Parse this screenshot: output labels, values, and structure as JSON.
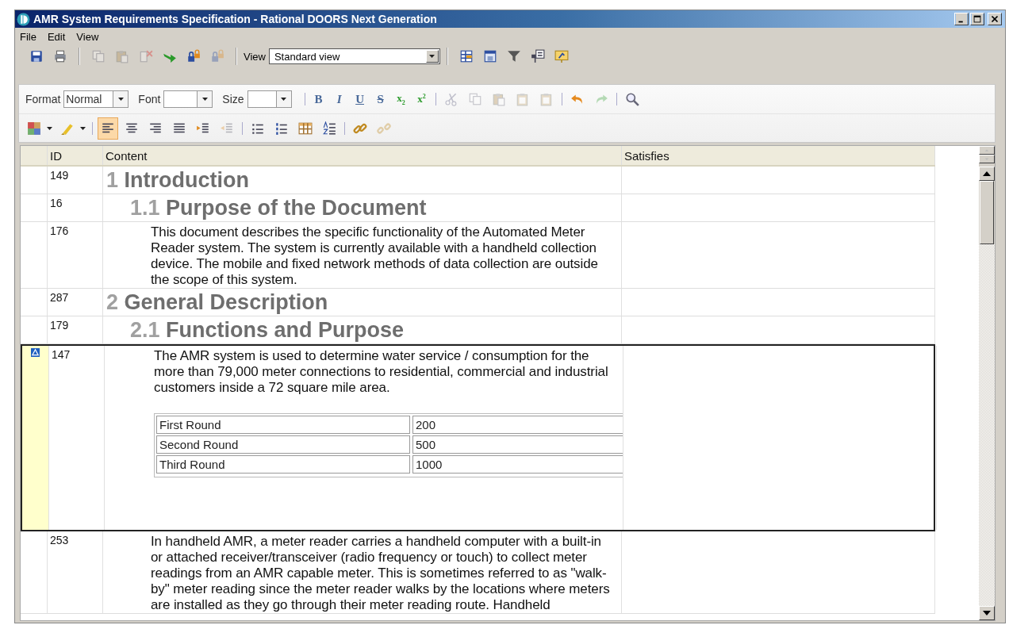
{
  "window": {
    "title": "AMR System Requirements Specification - Rational DOORS Next Generation"
  },
  "menu": [
    "File",
    "Edit",
    "View"
  ],
  "toolbar": {
    "file_buttons": [
      {
        "disabled": false
      },
      {
        "disabled": false
      }
    ],
    "edit_buttons": [
      {
        "disabled": true
      },
      {
        "disabled": true
      },
      {
        "disabled": true
      },
      {
        "disabled": false
      },
      {
        "disabled": false
      },
      {
        "disabled": true
      }
    ],
    "view": {
      "label": "View",
      "value": "Standard view"
    },
    "view_buttons": [
      {
        "disabled": false
      },
      {
        "disabled": false
      },
      {
        "disabled": false
      },
      {
        "disabled": false
      },
      {
        "disabled": false
      }
    ]
  },
  "editor": {
    "format": {
      "label": "Format",
      "value": "Normal"
    },
    "font": {
      "label": "Font"
    },
    "size": {
      "label": "Size"
    },
    "style_buttons": [
      {
        "kind": "bold",
        "label": "B"
      },
      {
        "kind": "italic",
        "label": "I"
      },
      {
        "kind": "underline",
        "label": "U"
      },
      {
        "kind": "strike",
        "label": "S"
      },
      {
        "kind": "subscript",
        "label": "x$_{2}$"
      },
      {
        "kind": "superscript",
        "label": "x$^{2}$"
      }
    ],
    "clipboard_buttons": [
      {
        "disabled": true
      },
      {
        "disabled": true
      },
      {
        "disabled": true
      },
      {
        "disabled": true
      },
      {
        "disabled": true
      }
    ],
    "history_buttons": [
      {
        "disabled": false
      },
      {
        "disabled": true
      }
    ],
    "find_buttons": [
      {
        "disabled": false
      }
    ],
    "color_buttons": [
      {
        "disabled": false
      },
      {
        "disabled": false
      }
    ],
    "align_buttons": [
      {
        "selected": true,
        "disabled": false
      },
      {
        "selected": false,
        "disabled": false
      },
      {
        "selected": false,
        "disabled": false
      },
      {
        "selected": false,
        "disabled": false
      },
      {
        "selected": false,
        "disabled": false
      },
      {
        "selected": false,
        "disabled": true
      }
    ],
    "list_buttons": [
      {
        "disabled": false
      },
      {
        "disabled": false
      },
      {
        "disabled": false
      },
      {
        "disabled": false
      }
    ],
    "link_buttons": [
      {
        "disabled": false
      },
      {
        "disabled": true
      }
    ]
  },
  "grid": {
    "columns": [
      "ID",
      "Content",
      "Satisfies"
    ],
    "rows": [
      {
        "id": "149",
        "kind": "chapter",
        "number": "1",
        "title": "Introduction",
        "selected": false,
        "flagged": false
      },
      {
        "id": "16",
        "kind": "section",
        "number": "1.1",
        "title": "Purpose of the Document",
        "selected": false,
        "flagged": false
      },
      {
        "id": "176",
        "kind": "text",
        "text": "This document describes the specific functionality of the Automated Meter Reader system. The system is currently available with a handheld collection device. The mobile and fixed network methods of data collection are outside the scope of this system.",
        "selected": false,
        "flagged": false
      },
      {
        "id": "287",
        "kind": "chapter",
        "number": "2",
        "title": "General Description",
        "selected": false,
        "flagged": false
      },
      {
        "id": "179",
        "kind": "section",
        "number": "2.1",
        "title": "Functions and Purpose",
        "selected": false,
        "flagged": false
      },
      {
        "id": "147",
        "kind": "text",
        "text": "The AMR system is used to determine water service / consumption for the more than 79,000 meter connections to residential, commercial and industrial customers inside a 72 square mile area.",
        "table": [
          [
            "First Round",
            "200"
          ],
          [
            "Second Round",
            "500"
          ],
          [
            "Third Round",
            "1000"
          ]
        ],
        "selected": true,
        "flagged": true
      },
      {
        "id": "253",
        "kind": "text",
        "text": "In handheld AMR, a meter reader carries a handheld computer with a built-in or attached receiver/transceiver (radio frequency or touch) to collect meter readings from an AMR capable meter. This is sometimes referred to as \"walk-by\" meter reading since the meter reader walks by the locations where meters are installed as they go through their meter reading route. Handheld",
        "selected": false,
        "flagged": false
      }
    ]
  }
}
